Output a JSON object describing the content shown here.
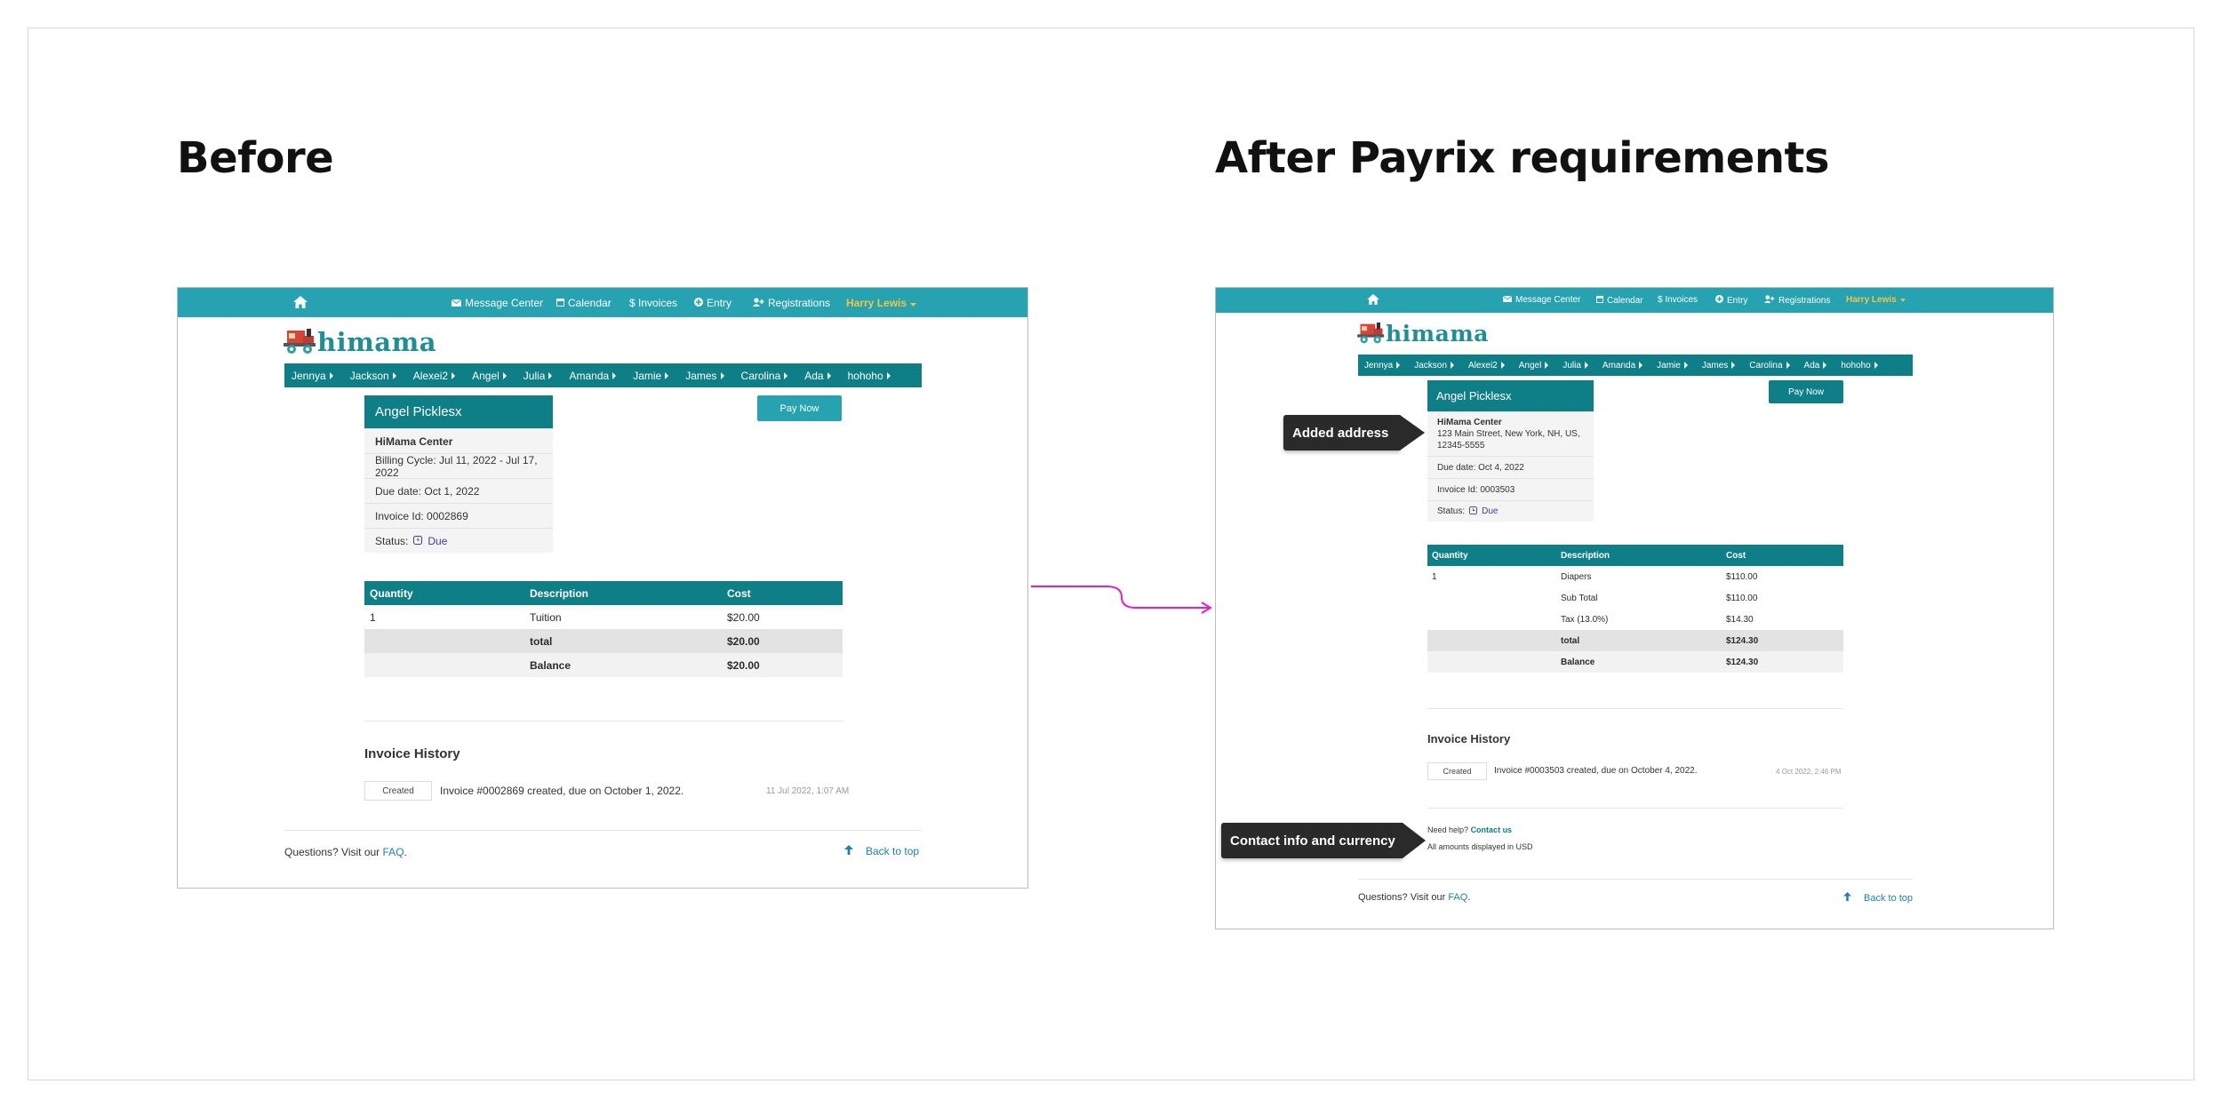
{
  "before": {
    "heading": "Before",
    "topbar": {
      "message_center": "Message Center",
      "calendar": "Calendar",
      "invoices": "$ Invoices",
      "entry": "Entry",
      "registrations": "Registrations",
      "user": "Harry Lewis"
    },
    "logo_text": "himama",
    "kids": [
      "Jennya",
      "Jackson",
      "Alexei2",
      "Angel",
      "Julia",
      "Amanda",
      "Jamie",
      "James",
      "Carolina",
      "Ada",
      "hohoho"
    ],
    "card": {
      "name": "Angel Picklesx",
      "center": "HiMama Center",
      "billing_cycle": "Billing Cycle: Jul 11, 2022 - Jul 17, 2022",
      "due_date": "Due date: Oct 1, 2022",
      "invoice_id": "Invoice Id: 0002869",
      "status_label": "Status:",
      "status_value": "Due"
    },
    "pay_now": "Pay Now",
    "table": {
      "headers": [
        "Quantity",
        "Description",
        "Cost"
      ],
      "rows": [
        {
          "qty": "1",
          "desc": "Tuition",
          "cost": "$20.00"
        }
      ],
      "total": {
        "label": "total",
        "value": "$20.00"
      },
      "balance": {
        "label": "Balance",
        "value": "$20.00"
      }
    },
    "history": {
      "title": "Invoice History",
      "badge": "Created",
      "text": "Invoice #0002869 created, due on October 1, 2022.",
      "time": "11 Jul 2022, 1:07 AM"
    },
    "footer": {
      "question": "Questions? Visit our",
      "faq": "FAQ",
      "period": ".",
      "back_to_top": "Back to top"
    }
  },
  "after": {
    "heading": "After Payrix requirements",
    "topbar": {
      "message_center": "Message Center",
      "calendar": "Calendar",
      "invoices": "$ Invoices",
      "entry": "Entry",
      "registrations": "Registrations",
      "user": "Harry Lewis"
    },
    "logo_text": "himama",
    "kids": [
      "Jennya",
      "Jackson",
      "Alexei2",
      "Angel",
      "Julia",
      "Amanda",
      "Jamie",
      "James",
      "Carolina",
      "Ada",
      "hohoho"
    ],
    "card": {
      "name": "Angel Picklesx",
      "center": "HiMama Center",
      "address_line1": "123 Main Street, New York, NH, US,",
      "address_line2": "12345-5555",
      "due_date": "Due date: Oct 4, 2022",
      "invoice_id": "Invoice Id: 0003503",
      "status_label": "Status:",
      "status_value": "Due"
    },
    "pay_now": "Pay Now",
    "table": {
      "headers": [
        "Quantity",
        "Description",
        "Cost"
      ],
      "rows": [
        {
          "qty": "1",
          "desc": "Diapers",
          "cost": "$110.00"
        },
        {
          "qty": "",
          "desc": "Sub Total",
          "cost": "$110.00"
        },
        {
          "qty": "",
          "desc": "Tax (13.0%)",
          "cost": "$14.30"
        }
      ],
      "total": {
        "label": "total",
        "value": "$124.30"
      },
      "balance": {
        "label": "Balance",
        "value": "$124.30"
      }
    },
    "history": {
      "title": "Invoice History",
      "badge": "Created",
      "text": "Invoice #0003503 created, due on October 4, 2022.",
      "time": "4 Oct 2022, 2:46 PM"
    },
    "help": {
      "need_help": "Need help?",
      "contact_us": "Contact us",
      "currency": "All amounts displayed in USD"
    },
    "footer": {
      "question": "Questions? Visit our",
      "faq": "FAQ",
      "period": ".",
      "back_to_top": "Back to top"
    },
    "callouts": {
      "address": "Added address",
      "contact": "Contact info and currency"
    }
  },
  "colors": {
    "topbar": "#26a2b0",
    "teal_dark": "#0f7f87",
    "user_name": "#f5c542",
    "connector": "#e61ec8",
    "callout": "#2a2a2a"
  },
  "icons": {
    "home": "home-icon",
    "message": "envelope-icon",
    "calendar": "calendar-icon",
    "entry": "plus-circle-icon",
    "registrations": "user-plus-icon",
    "status": "clock-icon",
    "back_to_top": "arrow-up-icon"
  }
}
